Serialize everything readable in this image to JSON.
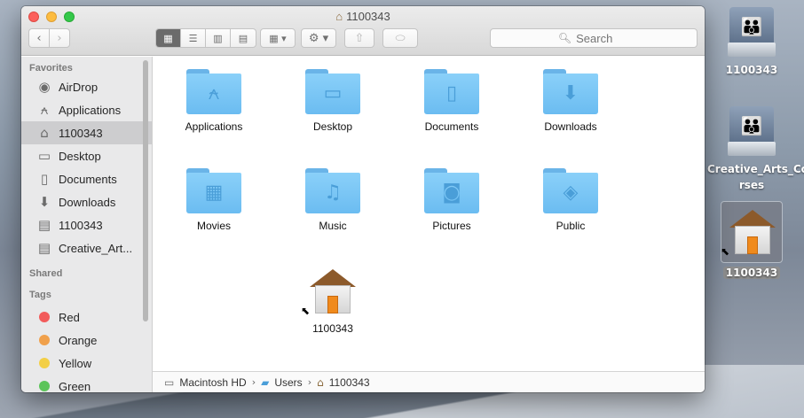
{
  "window": {
    "title": "1100343"
  },
  "toolbar": {
    "back_icon": "‹",
    "forward_icon": "›",
    "view_modes": [
      "icon-view",
      "list-view",
      "column-view",
      "coverflow-view"
    ],
    "search_placeholder": "Search"
  },
  "sidebar": {
    "favorites_header": "Favorites",
    "favorites": [
      {
        "label": "AirDrop",
        "icon": "airdrop-icon"
      },
      {
        "label": "Applications",
        "icon": "applications-icon"
      },
      {
        "label": "1100343",
        "icon": "home-icon",
        "selected": true
      },
      {
        "label": "Desktop",
        "icon": "desktop-icon"
      },
      {
        "label": "Documents",
        "icon": "documents-icon"
      },
      {
        "label": "Downloads",
        "icon": "downloads-icon"
      },
      {
        "label": "1100343",
        "icon": "network-drive-icon"
      },
      {
        "label": "Creative_Art...",
        "icon": "network-drive-icon"
      }
    ],
    "shared_header": "Shared",
    "tags_header": "Tags",
    "tags": [
      {
        "label": "Red",
        "color": "#f25b5b"
      },
      {
        "label": "Orange",
        "color": "#f0a04b"
      },
      {
        "label": "Yellow",
        "color": "#f3cf46"
      },
      {
        "label": "Green",
        "color": "#5cc45a"
      }
    ]
  },
  "content": {
    "items": [
      {
        "label": "Applications",
        "icon": "applications-folder-icon"
      },
      {
        "label": "Desktop",
        "icon": "desktop-folder-icon"
      },
      {
        "label": "Documents",
        "icon": "documents-folder-icon"
      },
      {
        "label": "Downloads",
        "icon": "downloads-folder-icon"
      },
      {
        "label": "Movies",
        "icon": "movies-folder-icon"
      },
      {
        "label": "Music",
        "icon": "music-folder-icon"
      },
      {
        "label": "Pictures",
        "icon": "pictures-folder-icon"
      },
      {
        "label": "Public",
        "icon": "public-folder-icon"
      },
      {
        "label": "1100343",
        "icon": "home-alias-icon"
      }
    ]
  },
  "pathbar": {
    "segments": [
      "Macintosh HD",
      "Users",
      "1100343"
    ]
  },
  "desktop": {
    "items": [
      {
        "label": "1100343",
        "icon": "network-drive-icon"
      },
      {
        "label": "Creative_Arts_Cou rses",
        "icon": "network-drive-icon"
      },
      {
        "label": "1100343",
        "icon": "home-alias-icon",
        "selected": true
      }
    ]
  },
  "colors": {
    "folder_blue": "#7cc6f5",
    "sidebar_bg": "#e9e9ea",
    "selected_row": "#cdcdcf"
  }
}
